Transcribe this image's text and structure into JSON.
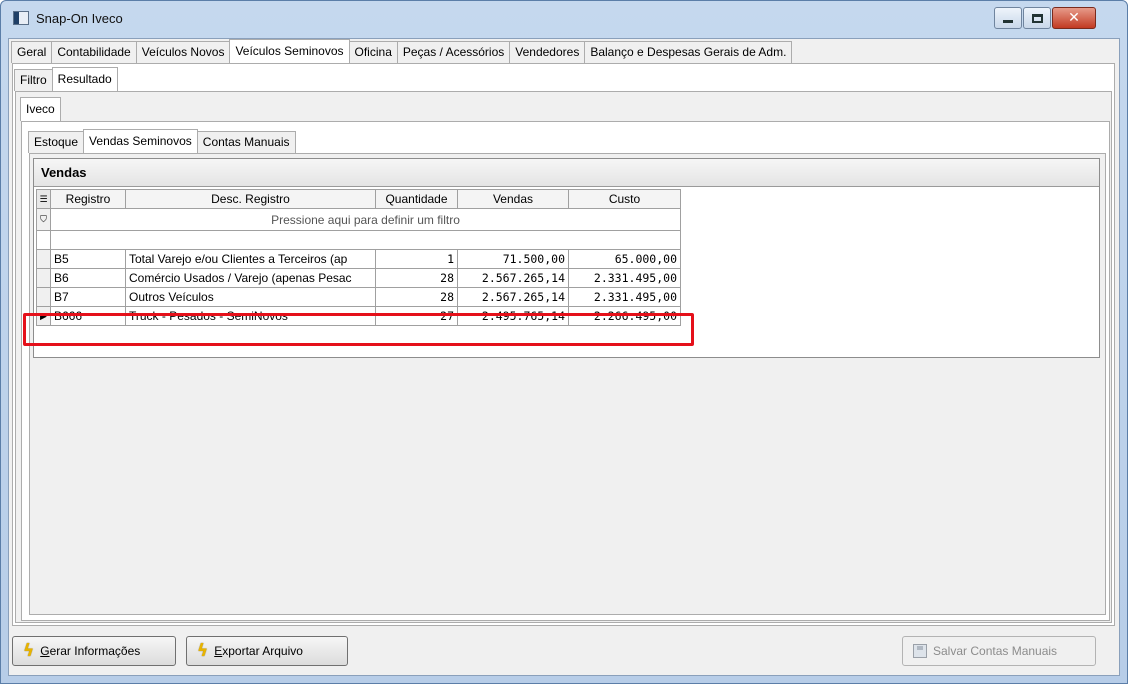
{
  "window": {
    "title": "Snap-On Iveco",
    "controls": {
      "min": "",
      "max": "",
      "close": "✕"
    }
  },
  "main_tabs": [
    "Geral",
    "Contabilidade",
    "Veículos Novos",
    "Veículos Seminovos",
    "Oficina",
    "Peças / Acessórios",
    "Vendedores",
    "Balanço e Despesas Gerais de Adm."
  ],
  "main_tab_active": "Veículos Seminovos",
  "sub_tabs": [
    "Filtro",
    "Resultado"
  ],
  "sub_tab_active": "Resultado",
  "brand_tabs": [
    "Iveco"
  ],
  "inner_tabs": [
    "Estoque",
    "Vendas Seminovos",
    "Contas Manuais"
  ],
  "inner_tab_active": "Vendas Seminovos",
  "group": {
    "title": "Vendas"
  },
  "grid": {
    "columns": [
      "Registro",
      "Desc. Registro",
      "Quantidade",
      "Vendas",
      "Custo"
    ],
    "filter_hint": "Pressione aqui para definir um filtro",
    "rows": [
      {
        "registro": "B5",
        "desc": "Total Varejo e/ou Clientes a Terceiros (ap",
        "quantidade": "1",
        "vendas": "71.500,00",
        "custo": "65.000,00"
      },
      {
        "registro": "B6",
        "desc": "Comércio Usados / Varejo (apenas Pesac",
        "quantidade": "28",
        "vendas": "2.567.265,14",
        "custo": "2.331.495,00"
      },
      {
        "registro": "B7",
        "desc": "Outros Veículos",
        "quantidade": "28",
        "vendas": "2.567.265,14",
        "custo": "2.331.495,00"
      },
      {
        "registro": "B666",
        "desc": "Truck - Pesados - SemiNovos",
        "quantidade": "27",
        "vendas": "2.495.765,14",
        "custo": "2.266.495,00"
      }
    ],
    "current_row_indicator": "▶"
  },
  "buttons": {
    "gerar": {
      "prefix": "",
      "accel": "G",
      "rest": "erar Informações",
      "icon": "lightning-icon"
    },
    "exportar": {
      "prefix": "",
      "accel": "E",
      "rest": "xportar Arquivo",
      "icon": "lightning-icon"
    },
    "salvar": {
      "label": "Salvar Contas Manuais",
      "icon": "disk-icon",
      "enabled": false
    }
  },
  "colors": {
    "highlight": "#e5101a",
    "bolt": "#e8b400"
  }
}
